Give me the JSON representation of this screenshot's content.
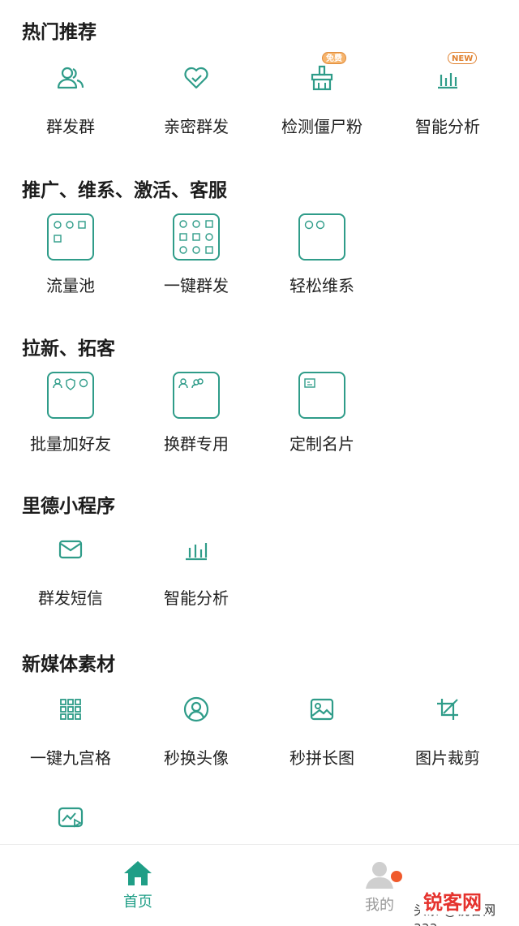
{
  "sections": {
    "hot": {
      "title": "热门推荐",
      "items": [
        {
          "label": "群发群",
          "icon": "users-icon"
        },
        {
          "label": "亲密群发",
          "icon": "heart-check-icon"
        },
        {
          "label": "检测僵尸粉",
          "icon": "broom-icon",
          "badge": "免费"
        },
        {
          "label": "智能分析",
          "icon": "bar-chart-icon",
          "badge": "NEW"
        }
      ]
    },
    "promo": {
      "title": "推广、维系、激活、客服",
      "items": [
        {
          "label": "流量池",
          "icon": "folder-grid-icon"
        },
        {
          "label": "一键群发",
          "icon": "folder-grid-icon"
        },
        {
          "label": "轻松维系",
          "icon": "folder-grid-icon"
        }
      ]
    },
    "acquire": {
      "title": "拉新、拓客",
      "items": [
        {
          "label": "批量加好友",
          "icon": "folder-grid-icon"
        },
        {
          "label": "换群专用",
          "icon": "folder-grid-icon"
        },
        {
          "label": "定制名片",
          "icon": "folder-grid-icon"
        }
      ]
    },
    "miniprogram": {
      "title": "里德小程序",
      "items": [
        {
          "label": "群发短信",
          "icon": "mail-icon"
        },
        {
          "label": "智能分析",
          "icon": "bar-chart-icon"
        }
      ]
    },
    "media": {
      "title": "新媒体素材",
      "items": [
        {
          "label": "一键九宫格",
          "icon": "grid-icon"
        },
        {
          "label": "秒换头像",
          "icon": "avatar-icon"
        },
        {
          "label": "秒拼长图",
          "icon": "image-icon"
        },
        {
          "label": "图片裁剪",
          "icon": "crop-icon"
        },
        {
          "label": "",
          "icon": "video-chart-icon"
        }
      ]
    }
  },
  "tabbar": {
    "home": "首页",
    "mine": "我的"
  },
  "watermark": {
    "text": "头条 @锐客网aaa",
    "logo": "锐客网"
  },
  "colors": {
    "accent": "#1f9e86",
    "icon": "#2f9c89",
    "badge_orange": "#e0812f",
    "notify_dot": "#f0592b"
  }
}
